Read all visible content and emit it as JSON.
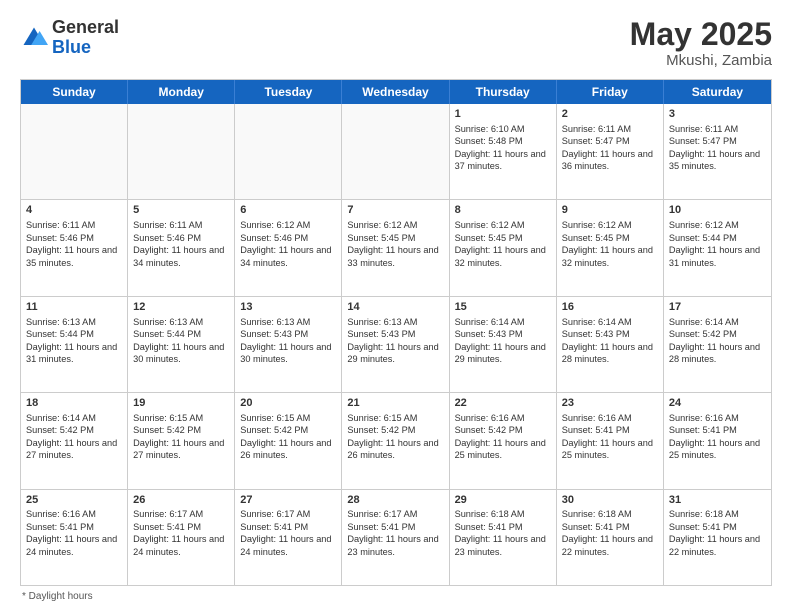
{
  "header": {
    "logo_general": "General",
    "logo_blue": "Blue",
    "month_year": "May 2025",
    "location": "Mkushi, Zambia"
  },
  "days_of_week": [
    "Sunday",
    "Monday",
    "Tuesday",
    "Wednesday",
    "Thursday",
    "Friday",
    "Saturday"
  ],
  "footer": {
    "label": "Daylight hours"
  },
  "weeks": [
    [
      {
        "day": "",
        "empty": true
      },
      {
        "day": "",
        "empty": true
      },
      {
        "day": "",
        "empty": true
      },
      {
        "day": "",
        "empty": true
      },
      {
        "day": "1",
        "sunrise": "6:10 AM",
        "sunset": "5:48 PM",
        "daylight": "11 hours and 37 minutes."
      },
      {
        "day": "2",
        "sunrise": "6:11 AM",
        "sunset": "5:47 PM",
        "daylight": "11 hours and 36 minutes."
      },
      {
        "day": "3",
        "sunrise": "6:11 AM",
        "sunset": "5:47 PM",
        "daylight": "11 hours and 35 minutes."
      }
    ],
    [
      {
        "day": "4",
        "sunrise": "6:11 AM",
        "sunset": "5:46 PM",
        "daylight": "11 hours and 35 minutes."
      },
      {
        "day": "5",
        "sunrise": "6:11 AM",
        "sunset": "5:46 PM",
        "daylight": "11 hours and 34 minutes."
      },
      {
        "day": "6",
        "sunrise": "6:12 AM",
        "sunset": "5:46 PM",
        "daylight": "11 hours and 34 minutes."
      },
      {
        "day": "7",
        "sunrise": "6:12 AM",
        "sunset": "5:45 PM",
        "daylight": "11 hours and 33 minutes."
      },
      {
        "day": "8",
        "sunrise": "6:12 AM",
        "sunset": "5:45 PM",
        "daylight": "11 hours and 32 minutes."
      },
      {
        "day": "9",
        "sunrise": "6:12 AM",
        "sunset": "5:45 PM",
        "daylight": "11 hours and 32 minutes."
      },
      {
        "day": "10",
        "sunrise": "6:12 AM",
        "sunset": "5:44 PM",
        "daylight": "11 hours and 31 minutes."
      }
    ],
    [
      {
        "day": "11",
        "sunrise": "6:13 AM",
        "sunset": "5:44 PM",
        "daylight": "11 hours and 31 minutes."
      },
      {
        "day": "12",
        "sunrise": "6:13 AM",
        "sunset": "5:44 PM",
        "daylight": "11 hours and 30 minutes."
      },
      {
        "day": "13",
        "sunrise": "6:13 AM",
        "sunset": "5:43 PM",
        "daylight": "11 hours and 30 minutes."
      },
      {
        "day": "14",
        "sunrise": "6:13 AM",
        "sunset": "5:43 PM",
        "daylight": "11 hours and 29 minutes."
      },
      {
        "day": "15",
        "sunrise": "6:14 AM",
        "sunset": "5:43 PM",
        "daylight": "11 hours and 29 minutes."
      },
      {
        "day": "16",
        "sunrise": "6:14 AM",
        "sunset": "5:43 PM",
        "daylight": "11 hours and 28 minutes."
      },
      {
        "day": "17",
        "sunrise": "6:14 AM",
        "sunset": "5:42 PM",
        "daylight": "11 hours and 28 minutes."
      }
    ],
    [
      {
        "day": "18",
        "sunrise": "6:14 AM",
        "sunset": "5:42 PM",
        "daylight": "11 hours and 27 minutes."
      },
      {
        "day": "19",
        "sunrise": "6:15 AM",
        "sunset": "5:42 PM",
        "daylight": "11 hours and 27 minutes."
      },
      {
        "day": "20",
        "sunrise": "6:15 AM",
        "sunset": "5:42 PM",
        "daylight": "11 hours and 26 minutes."
      },
      {
        "day": "21",
        "sunrise": "6:15 AM",
        "sunset": "5:42 PM",
        "daylight": "11 hours and 26 minutes."
      },
      {
        "day": "22",
        "sunrise": "6:16 AM",
        "sunset": "5:42 PM",
        "daylight": "11 hours and 25 minutes."
      },
      {
        "day": "23",
        "sunrise": "6:16 AM",
        "sunset": "5:41 PM",
        "daylight": "11 hours and 25 minutes."
      },
      {
        "day": "24",
        "sunrise": "6:16 AM",
        "sunset": "5:41 PM",
        "daylight": "11 hours and 25 minutes."
      }
    ],
    [
      {
        "day": "25",
        "sunrise": "6:16 AM",
        "sunset": "5:41 PM",
        "daylight": "11 hours and 24 minutes."
      },
      {
        "day": "26",
        "sunrise": "6:17 AM",
        "sunset": "5:41 PM",
        "daylight": "11 hours and 24 minutes."
      },
      {
        "day": "27",
        "sunrise": "6:17 AM",
        "sunset": "5:41 PM",
        "daylight": "11 hours and 24 minutes."
      },
      {
        "day": "28",
        "sunrise": "6:17 AM",
        "sunset": "5:41 PM",
        "daylight": "11 hours and 23 minutes."
      },
      {
        "day": "29",
        "sunrise": "6:18 AM",
        "sunset": "5:41 PM",
        "daylight": "11 hours and 23 minutes."
      },
      {
        "day": "30",
        "sunrise": "6:18 AM",
        "sunset": "5:41 PM",
        "daylight": "11 hours and 22 minutes."
      },
      {
        "day": "31",
        "sunrise": "6:18 AM",
        "sunset": "5:41 PM",
        "daylight": "11 hours and 22 minutes."
      }
    ]
  ]
}
